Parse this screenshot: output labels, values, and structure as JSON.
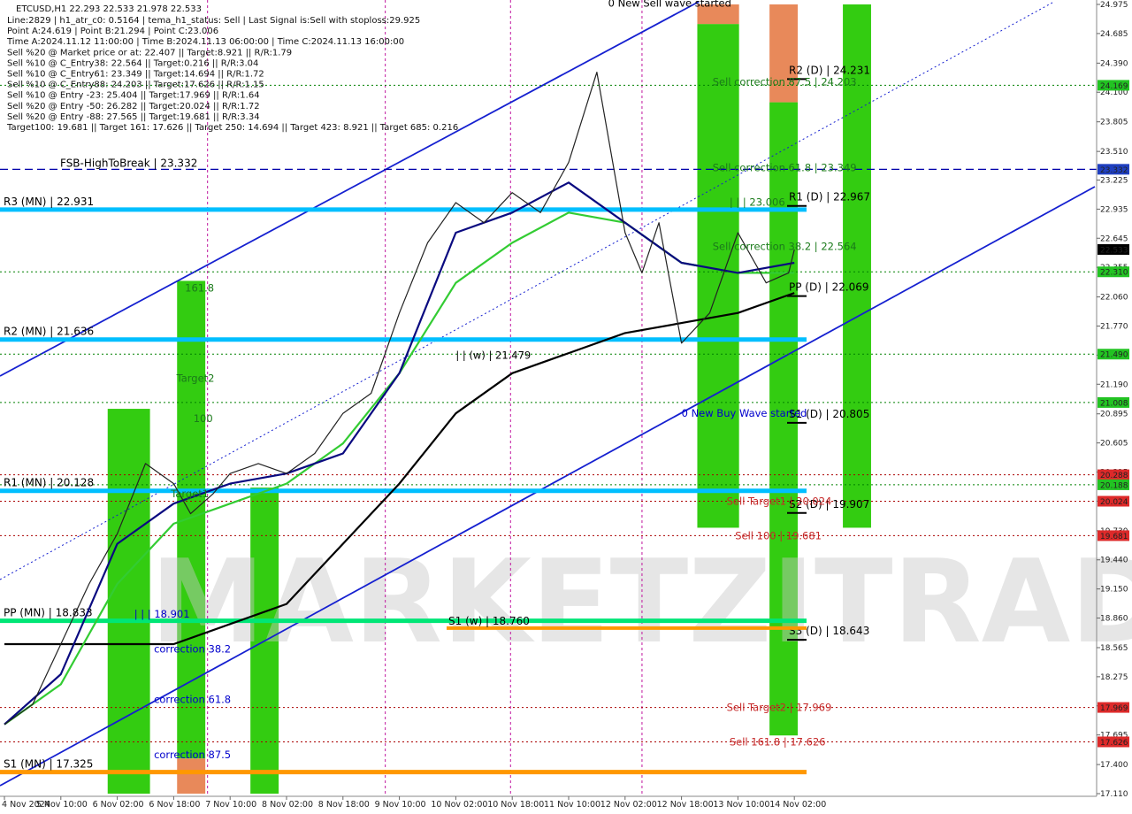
{
  "header": {
    "symbol_line": "ETCUSD,H1   22.293 22.533 21.978 22.533",
    "lines": [
      "Line:2829 | h1_atr_c0: 0.5164 | tema_h1_status: Sell | Last Signal is:Sell with stoploss:29.925",
      "Point A:24.619 | Point B:21.294 | Point C:23.006",
      "Time A:2024.11.12 11:00:00 | Time B:2024.11.13 06:00:00 | Time C:2024.11.13 16:00:00",
      "Sell %20 @ Market price or at: 22.407 || Target:8.921 || R/R:1.79",
      "Sell %10 @ C_Entry38: 22.564 || Target:0.216 || R/R:3.04",
      "Sell %10 @ C_Entry61: 23.349 || Target:14.694 || R/R:1.72",
      "Sell %10 @ C_Entry88: 24.203 || Target:17.626 || R/R:1.15",
      "Sell %10 @ Entry -23: 25.404 || Target:17.969 || R/R:1.64",
      "Sell %20 @ Entry -50: 26.282 || Target:20.024 || R/R:1.72",
      "Sell %20 @ Entry -88: 27.565 || Target:19.681 || R/R:3.34",
      "Target100: 19.681 || Target 161: 17.626 || Target 250: 14.694 || Target 423: 8.921 || Target 685: 0.216"
    ]
  },
  "watermark": "MARKETZITRADE",
  "chart_data": {
    "type": "line",
    "instrument": "ETCUSD",
    "timeframe": "H1",
    "ylim": [
      17.11,
      24.975
    ],
    "y_ticks": [
      "24.975",
      "24.685",
      "24.390",
      "24.100",
      "23.805",
      "23.510",
      "23.225",
      "22.935",
      "22.645",
      "22.355",
      "22.060",
      "21.770",
      "21.480",
      "21.190",
      "20.895",
      "20.605",
      "20.315",
      "20.025",
      "19.730",
      "19.440",
      "19.150",
      "18.860",
      "18.565",
      "18.275",
      "17.985",
      "17.695",
      "17.400",
      "17.110"
    ],
    "x_labels": [
      "4 Nov 2024",
      "5 Nov 10:00",
      "6 Nov 02:00",
      "6 Nov 18:00",
      "7 Nov 10:00",
      "8 Nov 02:00",
      "8 Nov 18:00",
      "9 Nov 10:00",
      "10 Nov 02:00",
      "10 Nov 18:00",
      "11 Nov 10:00",
      "12 Nov 02:00",
      "12 Nov 18:00",
      "13 Nov 10:00",
      "14 Nov 02:00"
    ],
    "x_units": 22,
    "price": {
      "x": [
        0,
        0.5,
        1,
        1.5,
        2,
        2.5,
        3,
        3.3,
        3.7,
        4,
        4.5,
        5,
        5.5,
        6,
        6.5,
        7,
        7.5,
        8,
        8.5,
        9,
        9.5,
        10,
        10.5,
        11,
        11.3,
        11.6,
        12,
        12.5,
        13,
        13.5,
        13.9,
        14
      ],
      "y": [
        17.8,
        18.0,
        18.6,
        19.2,
        19.7,
        20.4,
        20.2,
        19.9,
        20.1,
        20.3,
        20.4,
        20.3,
        20.5,
        20.9,
        21.1,
        21.9,
        22.6,
        23.0,
        22.8,
        23.1,
        22.9,
        23.4,
        24.3,
        22.7,
        22.3,
        22.8,
        21.6,
        21.9,
        22.7,
        22.2,
        22.3,
        22.533
      ]
    },
    "ma_black": {
      "x": [
        0,
        2,
        3,
        4,
        5,
        6,
        7,
        8,
        9,
        10,
        11,
        12,
        13,
        14
      ],
      "y": [
        18.6,
        18.6,
        18.6,
        18.8,
        19.0,
        19.6,
        20.2,
        20.9,
        21.3,
        21.5,
        21.7,
        21.8,
        21.9,
        22.1
      ]
    },
    "ma_navy": {
      "x": [
        0,
        1,
        2,
        3,
        4,
        5,
        6,
        7,
        8,
        9,
        10,
        11,
        12,
        13,
        14
      ],
      "y": [
        17.8,
        18.3,
        19.6,
        20.0,
        20.2,
        20.3,
        20.5,
        21.3,
        22.7,
        22.9,
        23.2,
        22.8,
        22.4,
        22.3,
        22.4
      ]
    },
    "ma_green": {
      "x": [
        0,
        1,
        2,
        3,
        4,
        5,
        6,
        7,
        8,
        9,
        10,
        11,
        12,
        13,
        14
      ],
      "y": [
        17.8,
        18.2,
        19.2,
        19.8,
        20.0,
        20.2,
        20.6,
        21.3,
        22.2,
        22.6,
        22.9,
        22.8,
        22.4,
        22.3,
        22.3
      ]
    },
    "horizontal_levels": [
      {
        "label": "R3 (MN) | 22.931",
        "value": 22.931,
        "color": "#00bfff",
        "style": "thick",
        "label_pos": "left"
      },
      {
        "label": "R2 (MN) | 21.636",
        "value": 21.636,
        "color": "#00bfff",
        "style": "thick",
        "label_pos": "left"
      },
      {
        "label": "R1 (MN) | 20.128",
        "value": 20.128,
        "color": "#00bfff",
        "style": "thick",
        "label_pos": "left"
      },
      {
        "label": "PP (MN) | 18.833",
        "value": 18.833,
        "color": "#00e676",
        "style": "thick",
        "label_pos": "left"
      },
      {
        "label": "S1 (MN) | 17.325",
        "value": 17.325,
        "color": "#ff9800",
        "style": "thick",
        "label_pos": "left"
      },
      {
        "label": "FSB-HighToBreak | 23.332",
        "value": 23.332,
        "color": "#0000aa",
        "style": "dash",
        "label_pos": "left"
      },
      {
        "label": "R2 (D) | 24.231",
        "value": 24.231,
        "color": "#000000",
        "style": "short",
        "label_pos": "right"
      },
      {
        "label": "R1 (D) | 22.967",
        "value": 22.967,
        "color": "#000000",
        "style": "short",
        "label_pos": "right"
      },
      {
        "label": "PP (D) | 22.069",
        "value": 22.069,
        "color": "#000000",
        "style": "short",
        "label_pos": "right"
      },
      {
        "label": "S1 (D) | 20.805",
        "value": 20.805,
        "color": "#000000",
        "style": "short",
        "label_pos": "right"
      },
      {
        "label": "S2 (D) | 19.907",
        "value": 19.907,
        "color": "#000000",
        "style": "short",
        "label_pos": "right"
      },
      {
        "label": "S3 (D) | 18.643",
        "value": 18.643,
        "color": "#000000",
        "style": "short",
        "label_pos": "right"
      },
      {
        "label": "S1 (w) | 18.760",
        "value": 18.76,
        "color": "#ff9800",
        "style": "thick",
        "label_pos": "mid"
      }
    ],
    "dotted_levels": [
      {
        "value": 24.169,
        "color": "#008000",
        "tag": "24.169",
        "tag_bg": "#22c322"
      },
      {
        "value": 22.31,
        "color": "#008000",
        "tag": "22.310",
        "tag_bg": "#22c322"
      },
      {
        "value": 21.49,
        "color": "#008000",
        "tag": "21.490",
        "tag_bg": "#22c322"
      },
      {
        "value": 21.008,
        "color": "#008000",
        "tag": "21.008",
        "tag_bg": "#22c322"
      },
      {
        "value": 20.288,
        "color": "#aa0000",
        "tag": "20.288",
        "tag_bg": "#dd2a2a"
      },
      {
        "value": 20.188,
        "color": "#008000",
        "tag": "20.188",
        "tag_bg": "#22c322"
      },
      {
        "value": 20.024,
        "color": "#aa0000",
        "tag": "20.024",
        "tag_bg": "#dd2a2a"
      },
      {
        "value": 19.681,
        "color": "#aa0000",
        "tag": "19.681",
        "tag_bg": "#dd2a2a"
      },
      {
        "value": 17.969,
        "color": "#aa0000",
        "tag": "17.969",
        "tag_bg": "#dd2a2a"
      },
      {
        "value": 17.626,
        "color": "#aa0000",
        "tag": "17.626",
        "tag_bg": "#dd2a2a"
      }
    ],
    "right_tags": [
      {
        "value": 23.332,
        "text": "23.332",
        "bg": "#1f3fbf"
      },
      {
        "value": 22.533,
        "text": "22.533",
        "bg": "#000000"
      }
    ],
    "annotations": [
      {
        "text": "Sell correction 87.5 | 24.203",
        "x": 12.55,
        "value": 24.203,
        "color": "#1a7a1a"
      },
      {
        "text": "| | | 23.006",
        "x": 12.85,
        "value": 23.006,
        "color": "#1a7a1a"
      },
      {
        "text": "Sell correction 61.8 | 23.349",
        "x": 12.55,
        "value": 23.349,
        "color": "#1a7a1a"
      },
      {
        "text": "Sell correction 38.2 | 22.564",
        "x": 12.55,
        "value": 22.564,
        "color": "#1a7a1a"
      },
      {
        "text": "| | (w) | 21.479",
        "x": 8.0,
        "value": 21.479,
        "color": "#000000"
      },
      {
        "text": "0 New Buy Wave started",
        "x": 12.0,
        "value": 20.9,
        "color": "#0000cc"
      },
      {
        "text": "Sell Target1 | 20.024",
        "x": 12.8,
        "value": 20.024,
        "color": "#c62828"
      },
      {
        "text": "Sell 100 | 19.681",
        "x": 12.95,
        "value": 19.681,
        "color": "#c62828"
      },
      {
        "text": "Sell Target2 | 17.969",
        "x": 12.8,
        "value": 17.969,
        "color": "#c62828"
      },
      {
        "text": "Sell 161.8 | 17.626",
        "x": 12.85,
        "value": 17.626,
        "color": "#c62828"
      },
      {
        "text": "161.8",
        "x": 3.2,
        "value": 22.15,
        "color": "#1a7a1a"
      },
      {
        "text": "Target2",
        "x": 3.05,
        "value": 21.25,
        "color": "#1a7a1a"
      },
      {
        "text": "100",
        "x": 3.35,
        "value": 20.85,
        "color": "#1a7a1a"
      },
      {
        "text": "Target1",
        "x": 2.95,
        "value": 20.1,
        "color": "#1a7a1a"
      },
      {
        "text": "| | | 18.901",
        "x": 2.3,
        "value": 18.901,
        "color": "#0000cc"
      },
      {
        "text": "correction 38.2",
        "x": 2.65,
        "value": 18.55,
        "color": "#0000cc"
      },
      {
        "text": "correction 61.8",
        "x": 2.65,
        "value": 18.05,
        "color": "#0000cc"
      },
      {
        "text": "correction 87.5",
        "x": 2.65,
        "value": 17.5,
        "color": "#0000cc"
      },
      {
        "text": "0 New Sell wave started",
        "x": 10.7,
        "value": 24.99,
        "color": "#000000"
      }
    ],
    "zones": [
      {
        "x0": 1.83,
        "x1": 2.58,
        "top": 20.945,
        "bottom": 17.11,
        "color": "#33cc11"
      },
      {
        "x0": 3.06,
        "x1": 3.56,
        "top": 22.22,
        "bottom": 17.46,
        "color": "#33cc11"
      },
      {
        "x0": 3.06,
        "x1": 3.56,
        "top": 17.46,
        "bottom": 17.11,
        "color": "#e8895a"
      },
      {
        "x0": 4.36,
        "x1": 4.86,
        "top": 20.16,
        "bottom": 17.11,
        "color": "#33cc11"
      },
      {
        "x0": 12.28,
        "x1": 13.02,
        "top": 24.78,
        "bottom": 19.76,
        "color": "#33cc11"
      },
      {
        "x0": 12.28,
        "x1": 13.02,
        "top": 24.975,
        "bottom": 24.78,
        "color": "#e8895a"
      },
      {
        "x0": 13.56,
        "x1": 14.06,
        "top": 24.0,
        "bottom": 17.69,
        "color": "#33cc11"
      },
      {
        "x0": 13.56,
        "x1": 14.06,
        "top": 24.975,
        "bottom": 24.0,
        "color": "#e8895a"
      },
      {
        "x0": 14.86,
        "x1": 15.36,
        "top": 24.975,
        "bottom": 19.76,
        "color": "#33cc11"
      }
    ],
    "grid": false
  }
}
